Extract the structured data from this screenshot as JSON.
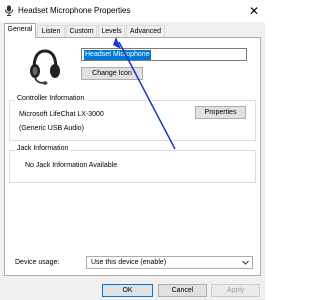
{
  "window": {
    "title": "Headset Microphone Properties",
    "close_glyph": "✕",
    "title_icon": "microphone-icon"
  },
  "tabs": [
    {
      "label": "General",
      "active": true
    },
    {
      "label": "Listen",
      "active": false
    },
    {
      "label": "Custom",
      "active": false
    },
    {
      "label": "Levels",
      "active": false
    },
    {
      "label": "Advanced",
      "active": false
    }
  ],
  "general": {
    "device_icon": "headset-icon",
    "device_name": "Headset Microphone",
    "change_icon_label": "Change Icon"
  },
  "controller": {
    "title": "Controller Information",
    "name": "Microsoft LifeChat LX-3000",
    "driver": "(Generic USB Audio)",
    "properties_label": "Properties"
  },
  "jack": {
    "title": "Jack Information",
    "text": "No Jack Information Available"
  },
  "device_usage": {
    "label": "Device usage:",
    "value": "Use this device (enable)"
  },
  "footer": {
    "ok": "OK",
    "cancel": "Cancel",
    "apply": "Apply"
  },
  "colors": {
    "accent": "#0078d7",
    "annotation_arrow": "#1a33cc"
  }
}
